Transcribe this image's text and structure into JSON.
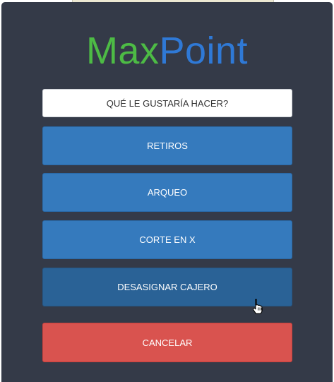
{
  "brand": {
    "name_part1": "Max",
    "name_part2": "Point",
    "color_part1": "#4dbb45",
    "color_part2": "#2f79d6"
  },
  "prompt": {
    "text": "QUÉ LE GUSTARÍA HACER?"
  },
  "menu": {
    "retiros_label": "RETIROS",
    "arqueo_label": "ARQUEO",
    "corte_label": "CORTE EN X",
    "desasignar_label": "DESASIGNAR CAJERO",
    "cancelar_label": "CANCELAR"
  },
  "colors": {
    "panel_bg": "#343a48",
    "primary_button": "#357abd",
    "primary_button_hover": "#2a6296",
    "danger_button": "#d9534f"
  },
  "icons": {
    "cursor": "hand-pointer-icon"
  }
}
